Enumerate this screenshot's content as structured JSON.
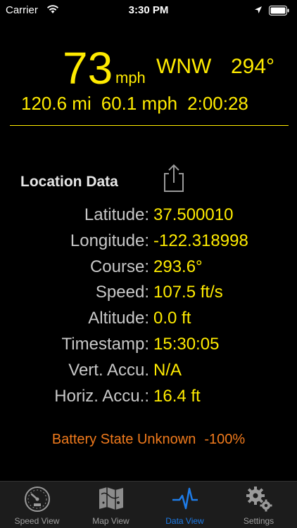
{
  "status_bar": {
    "carrier": "Carrier",
    "time": "3:30 PM"
  },
  "header": {
    "speed": "73",
    "speed_unit": "mph",
    "heading": "WNW",
    "degrees": "294°",
    "distance": "120.6 mi",
    "avg_speed": "60.1 mph",
    "elapsed": "2:00:28"
  },
  "location": {
    "title": "Location Data",
    "rows": [
      {
        "label": "Latitude:",
        "value": "37.500010"
      },
      {
        "label": "Longitude:",
        "value": "-122.318998"
      },
      {
        "label": "Course:",
        "value": "293.6°"
      },
      {
        "label": "Speed:",
        "value": "107.5 ft/s"
      },
      {
        "label": "Altitude:",
        "value": "0.0 ft"
      },
      {
        "label": "Timestamp:",
        "value": "15:30:05"
      },
      {
        "label": "Vert. Accu.",
        "value": "N/A"
      },
      {
        "label": "Horiz. Accu.:",
        "value": "16.4 ft"
      }
    ]
  },
  "battery": {
    "state": "Battery State Unknown",
    "percent": "-100%"
  },
  "tabs": [
    {
      "label": "Speed View",
      "icon": "speedometer-icon"
    },
    {
      "label": "Map View",
      "icon": "map-icon"
    },
    {
      "label": "Data View",
      "icon": "pulse-icon"
    },
    {
      "label": "Settings",
      "icon": "gears-icon"
    }
  ],
  "colors": {
    "accent": "#ffeb00",
    "battery": "#f07a1c",
    "tab_active": "#1e7ce8"
  }
}
